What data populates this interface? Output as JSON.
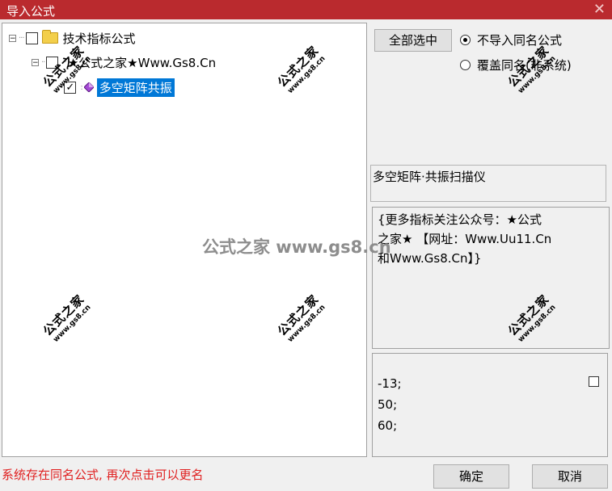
{
  "window": {
    "title": "导入公式",
    "close": "✕"
  },
  "tree": {
    "root": {
      "expander": "−",
      "label": "技术指标公式"
    },
    "group": {
      "expander": "−",
      "label": "★公式之家★Www.Gs8.Cn"
    },
    "item": {
      "check": "✓",
      "label": "多空矩阵共振"
    }
  },
  "actions": {
    "select_all": "全部选中",
    "options": [
      {
        "label": "不导入同名公式",
        "selected": true
      },
      {
        "label": "覆盖同名(非系统)",
        "selected": false
      }
    ]
  },
  "formula": {
    "description": "多空矩阵·共振扫描仪",
    "info_lines": [
      "{更多指标关注公众号：★公式",
      "之家★ 【网址：Www.Uu11.Cn",
      "和Www.Gs8.Cn】}"
    ],
    "params": [
      "-13;",
      "50;",
      "60;"
    ]
  },
  "status": "系统存在同名公式, 再次点击可以更名",
  "buttons": {
    "ok": "确定",
    "cancel": "取消"
  },
  "watermark": {
    "text": "公式之家",
    "url": "www.gs8.cn",
    "center": "公式之家 www.gs8.cn"
  },
  "colors": {
    "title_bar": "#ba2a2e",
    "selection": "#0078d7",
    "status": "#e02020"
  }
}
